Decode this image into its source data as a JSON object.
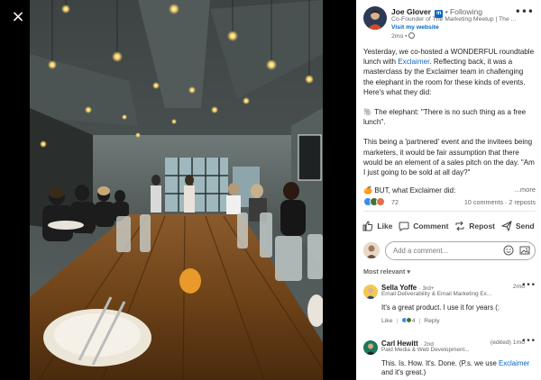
{
  "post": {
    "author": {
      "name": "Joe Glover",
      "badge": "in",
      "following": "• Following",
      "headline": "Co-Founder of The Marketing Meetup | The ...",
      "visit_link": "Visit my website",
      "meta": "2mo •"
    },
    "text": {
      "p1_before": "Yesterday, we co-hosted a WONDERFUL roundtable lunch with ",
      "p1_mention": "Exclaimer",
      "p1_after": ". Reflecting back, it was a masterclass by the Exclaimer team in challenging the elephant in the room for these kinds of events. Here's what they did:",
      "p2": "🐘 The elephant: \"There is no such thing as a free lunch\".",
      "p3": "This being a 'partnered' event and the invitees being marketers, it would be fair assumption that there would be an element of a sales pitch on the day. \"Am I just going to be sold at all day?\"",
      "truncated": "🍊 BUT, what Exclaimer did:",
      "see_more": "...more"
    },
    "social": {
      "reaction_count": "72",
      "comments_reposts": "10 comments · 2 reposts"
    },
    "actions": {
      "like": "Like",
      "comment": "Comment",
      "repost": "Repost",
      "send": "Send"
    },
    "comment_input": {
      "placeholder": "Add a comment..."
    },
    "sort_label": "Most relevant ▾"
  },
  "comments": [
    {
      "name": "Sella Yoffe",
      "degree": "· 3rd+",
      "title": "Email Deliverability & Email Marketing Ex...",
      "time": "2mo",
      "text": "It's a great product. I use it for years (:",
      "like_label": "Like",
      "like_count": "4",
      "reply_label": "Reply"
    },
    {
      "name": "Carl Hewitt",
      "degree": "· 2nd",
      "title": "Paid Media & Web Development...",
      "time": "(edited) 1mo",
      "text_before": "This. Is. How. It's. Done. (P.s. we use ",
      "text_mention": "Exclaimer",
      "text_after": " and it's great.)"
    }
  ],
  "viewer": {
    "close_icon": "×"
  },
  "colors": {
    "link_blue": "#0a66c2",
    "text_muted": "#666666",
    "like_blue": "#378fe9",
    "celebrate_green": "#44712e",
    "love_orange": "#df704d"
  }
}
